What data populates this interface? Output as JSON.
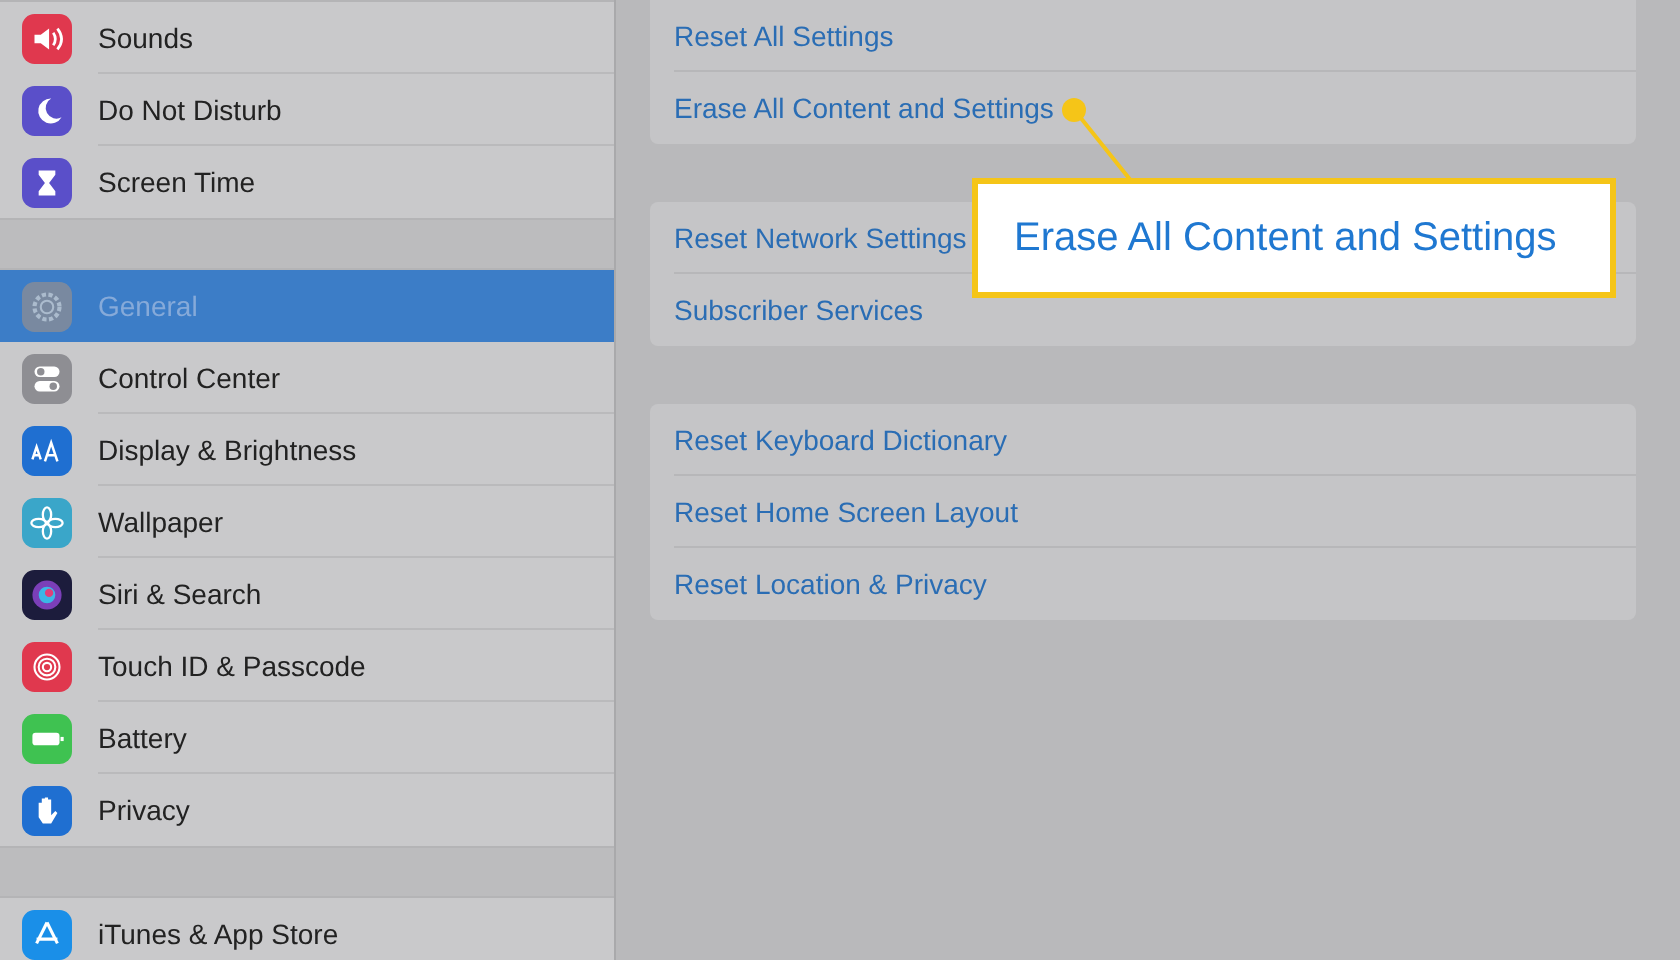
{
  "sidebar": {
    "groups": [
      {
        "items": [
          {
            "label": "Sounds",
            "selected": false
          },
          {
            "label": "Do Not Disturb",
            "selected": false
          },
          {
            "label": "Screen Time",
            "selected": false
          }
        ]
      },
      {
        "items": [
          {
            "label": "General",
            "selected": true
          },
          {
            "label": "Control Center",
            "selected": false
          },
          {
            "label": "Display & Brightness",
            "selected": false
          },
          {
            "label": "Wallpaper",
            "selected": false
          },
          {
            "label": "Siri & Search",
            "selected": false
          },
          {
            "label": "Touch ID & Passcode",
            "selected": false
          },
          {
            "label": "Battery",
            "selected": false
          },
          {
            "label": "Privacy",
            "selected": false
          }
        ]
      },
      {
        "items": [
          {
            "label": "iTunes & App Store",
            "selected": false
          }
        ]
      }
    ]
  },
  "detail": {
    "groups": [
      {
        "items": [
          "Reset All Settings",
          "Erase All Content and Settings"
        ]
      },
      {
        "items": [
          "Reset Network Settings",
          "Subscriber Services"
        ]
      },
      {
        "items": [
          "Reset Keyboard Dictionary",
          "Reset Home Screen Layout",
          "Reset Location & Privacy"
        ]
      }
    ]
  },
  "callout": {
    "text": "Erase All Content and Settings"
  }
}
